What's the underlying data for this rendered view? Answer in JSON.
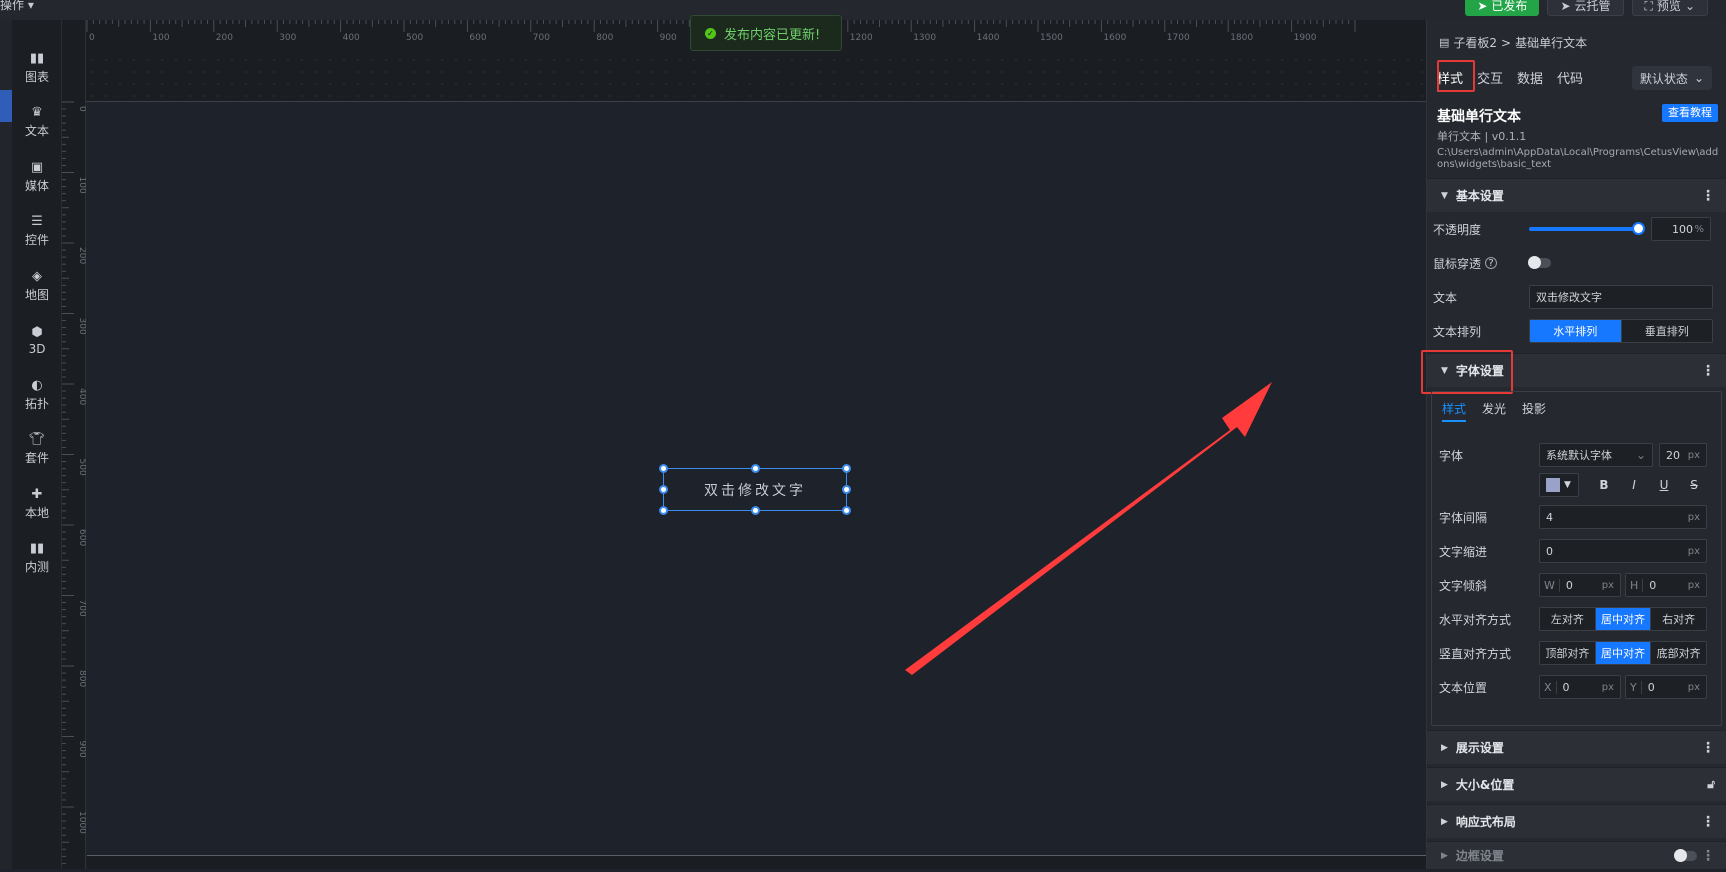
{
  "topbar": {
    "menu_label": "操作 ▾",
    "published_label": "已发布",
    "cloud_label": "云托管",
    "preview_label": "预览"
  },
  "sidebar": {
    "items": [
      {
        "label": "图表",
        "icon": "chart-icon"
      },
      {
        "label": "文本",
        "icon": "text-crown-icon"
      },
      {
        "label": "媒体",
        "icon": "media-icon"
      },
      {
        "label": "控件",
        "icon": "controls-icon"
      },
      {
        "label": "地图",
        "icon": "map-icon"
      },
      {
        "label": "3D",
        "icon": "cube-icon"
      },
      {
        "label": "拓扑",
        "icon": "topology-icon"
      },
      {
        "label": "套件",
        "icon": "shirt-icon"
      },
      {
        "label": "本地",
        "icon": "puzzle-icon"
      },
      {
        "label": "内测",
        "icon": "beta-chart-icon"
      }
    ]
  },
  "ruler": {
    "top": [
      "0",
      "100",
      "200",
      "300",
      "400",
      "500",
      "600",
      "700",
      "800",
      "900",
      "1000",
      "1100",
      "1200",
      "1300",
      "1400",
      "1500",
      "1600",
      "1700",
      "1800",
      "1900"
    ],
    "left": [
      "0",
      "100",
      "200",
      "300",
      "400",
      "500",
      "600",
      "700",
      "800",
      "900",
      "1000"
    ]
  },
  "toast": {
    "message": "发布内容已更新!"
  },
  "canvas": {
    "widget_text": "双击修改文字"
  },
  "panel": {
    "breadcrumb": {
      "parent": "子看板2",
      "sep": ">",
      "current": "基础单行文本"
    },
    "tabs": [
      "样式",
      "交互",
      "数据",
      "代码"
    ],
    "state": "默认状态",
    "widget": {
      "name": "基础单行文本",
      "version": "单行文本 | v0.1.1",
      "path": "C:\\Users\\admin\\AppData\\Local\\Programs\\CetusView\\addons\\widgets\\basic_text",
      "tutorial": "查看教程"
    },
    "basic": {
      "title": "基本设置",
      "opacity_label": "不透明度",
      "opacity_value": "100",
      "opacity_unit": "%",
      "opacity_level": 1.0,
      "mouse_through_label": "鼠标穿透",
      "text_label": "文本",
      "text_value": "双击修改文字",
      "arrange_label": "文本排列",
      "arrange_options": [
        "水平排列",
        "垂直排列"
      ]
    },
    "font": {
      "title": "字体设置",
      "subtabs": [
        "样式",
        "发光",
        "投影"
      ],
      "font_label": "字体",
      "font_value": "系统默认字体",
      "size_value": "20",
      "unit": "px",
      "spacing_label": "字体间隔",
      "spacing_value": "4",
      "indent_label": "文字缩进",
      "indent_value": "0",
      "skew_label": "文字倾斜",
      "skew_w_label": "W",
      "skew_w_value": "0",
      "skew_h_label": "H",
      "skew_h_value": "0",
      "halign_label": "水平对齐方式",
      "halign_options": [
        "左对齐",
        "居中对齐",
        "右对齐"
      ],
      "valign_label": "竖直对齐方式",
      "valign_options": [
        "顶部对齐",
        "居中对齐",
        "底部对齐"
      ],
      "pos_label": "文本位置",
      "pos_x_label": "X",
      "pos_x_value": "0",
      "pos_y_label": "Y",
      "pos_y_value": "0",
      "bold": "B",
      "italic": "I",
      "underline": "U",
      "strike": "S"
    },
    "sections": [
      "展示设置",
      "大小&位置",
      "响应式布局",
      "边框设置"
    ]
  },
  "colors": {
    "accent": "#1677ff",
    "highlight": "#e53935",
    "success": "#22a447"
  }
}
